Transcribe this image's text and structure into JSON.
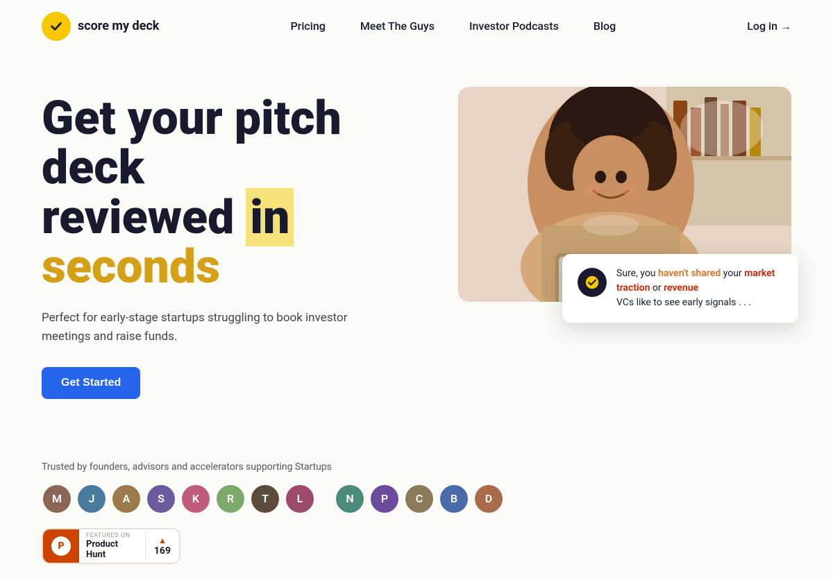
{
  "logo": {
    "text": "score my deck"
  },
  "nav": {
    "links": [
      {
        "label": "Pricing",
        "href": "#"
      },
      {
        "label": "Meet The Guys",
        "href": "#"
      },
      {
        "label": "Investor Podcasts",
        "href": "#"
      },
      {
        "label": "Blog",
        "href": "#"
      }
    ],
    "login_label": "Log in →"
  },
  "hero": {
    "title_line1": "Get your pitch",
    "title_line2": "deck",
    "title_line3": "reviewed",
    "title_highlight1": "in",
    "title_line4": "seconds",
    "subtitle": "Perfect for early-stage startups struggling to book investor meetings and raise funds.",
    "cta_label": "Get Started"
  },
  "feedback_card": {
    "text_normal1": "Sure, you ",
    "text_orange1": "haven't shared",
    "text_normal2": " your ",
    "text_red1": "market traction",
    "text_normal3": " or ",
    "text_red2": "revenue",
    "text_normal4": " VCs like to see early signals . . ."
  },
  "social_proof": {
    "trusted_text": "Trusted by founders, advisors and accelerators supporting Startups",
    "avatars": [
      {
        "id": 1,
        "initials": "M",
        "color": "av1"
      },
      {
        "id": 2,
        "initials": "J",
        "color": "av2"
      },
      {
        "id": 3,
        "initials": "A",
        "color": "av3"
      },
      {
        "id": 4,
        "initials": "S",
        "color": "av4"
      },
      {
        "id": 5,
        "initials": "K",
        "color": "av5"
      },
      {
        "id": 6,
        "initials": "R",
        "color": "av6"
      },
      {
        "id": 7,
        "initials": "T",
        "color": "av7"
      },
      {
        "id": 8,
        "initials": "L",
        "color": "av8"
      },
      {
        "id": 9,
        "initials": "N",
        "color": "av9"
      },
      {
        "id": 10,
        "initials": "P",
        "color": "av10"
      },
      {
        "id": 11,
        "initials": "C",
        "color": "av11"
      },
      {
        "id": 12,
        "initials": "B",
        "color": "av12"
      },
      {
        "id": 13,
        "initials": "D",
        "color": "av13"
      }
    ],
    "product_hunt": {
      "featured_text": "FEATURED ON",
      "name": "Product Hunt",
      "count": "169"
    }
  }
}
